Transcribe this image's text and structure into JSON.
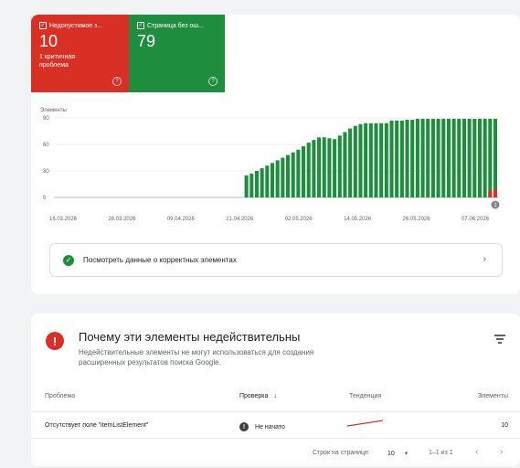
{
  "summary": {
    "invalid": {
      "label": "Недопустимое з...",
      "count": "10",
      "sub": "1 критичная проблема"
    },
    "valid": {
      "label": "Страница без ош...",
      "count": "79"
    }
  },
  "colors": {
    "invalid": "#d93025",
    "valid": "#1e8e3e",
    "grid": "#e8eaed"
  },
  "chart_data": {
    "type": "bar",
    "stacked": true,
    "ylabel": "Элементы",
    "yticks": [
      0,
      30,
      60,
      90
    ],
    "ylim": [
      0,
      90
    ],
    "xtick_labels": [
      "16.03.2026",
      "28.03.2026",
      "09.04.2026",
      "21.04.2026",
      "02.05.2026",
      "14.05.2026",
      "26.05.2026",
      "07.06.2026"
    ],
    "x_start": "2026-03-16",
    "x_end": "2026-06-10",
    "annotation_marker": {
      "date": "2026-06-10",
      "label": "1"
    },
    "series": [
      {
        "name": "Страница без ошибок",
        "color": "#1e8e3e",
        "points": [
          [
            "2026-04-23",
            25
          ],
          [
            "2026-04-24",
            27
          ],
          [
            "2026-04-25",
            30
          ],
          [
            "2026-04-26",
            33
          ],
          [
            "2026-04-27",
            36
          ],
          [
            "2026-04-28",
            39
          ],
          [
            "2026-04-29",
            42
          ],
          [
            "2026-04-30",
            45
          ],
          [
            "2026-05-01",
            48
          ],
          [
            "2026-05-02",
            51
          ],
          [
            "2026-05-03",
            54
          ],
          [
            "2026-05-04",
            58
          ],
          [
            "2026-05-05",
            62
          ],
          [
            "2026-05-06",
            65
          ],
          [
            "2026-05-07",
            68
          ],
          [
            "2026-05-08",
            68
          ],
          [
            "2026-05-09",
            67
          ],
          [
            "2026-05-10",
            66
          ],
          [
            "2026-05-11",
            70
          ],
          [
            "2026-05-12",
            74
          ],
          [
            "2026-05-13",
            78
          ],
          [
            "2026-05-14",
            81
          ],
          [
            "2026-05-15",
            83
          ],
          [
            "2026-05-16",
            84
          ],
          [
            "2026-05-17",
            84
          ],
          [
            "2026-05-18",
            84
          ],
          [
            "2026-05-19",
            84
          ],
          [
            "2026-05-20",
            84
          ],
          [
            "2026-05-21",
            87
          ],
          [
            "2026-05-22",
            87
          ],
          [
            "2026-05-23",
            87
          ],
          [
            "2026-05-24",
            88
          ],
          [
            "2026-05-25",
            88
          ],
          [
            "2026-05-26",
            89
          ],
          [
            "2026-05-27",
            89
          ],
          [
            "2026-05-28",
            89
          ],
          [
            "2026-05-29",
            89
          ],
          [
            "2026-05-30",
            89
          ],
          [
            "2026-05-31",
            89
          ],
          [
            "2026-06-01",
            89
          ],
          [
            "2026-06-02",
            89
          ],
          [
            "2026-06-03",
            89
          ],
          [
            "2026-06-04",
            89
          ],
          [
            "2026-06-05",
            89
          ],
          [
            "2026-06-06",
            89
          ],
          [
            "2026-06-07",
            89
          ],
          [
            "2026-06-08",
            89
          ],
          [
            "2026-06-09",
            89
          ],
          [
            "2026-06-10",
            89
          ]
        ]
      },
      {
        "name": "Недопустимое значение",
        "color": "#d93025",
        "points": [
          [
            "2026-06-09",
            7
          ],
          [
            "2026-06-10",
            10
          ]
        ]
      }
    ]
  },
  "view_button": {
    "label": "Посмотреть данные о корректных элементах"
  },
  "issues": {
    "title": "Почему эти элементы недействительны",
    "description": "Недействительные элементы не могут использоваться для создания расширенных результатов поиска Google.",
    "columns": {
      "problem": "Проблема",
      "check": "Проверка",
      "trend": "Тенденция",
      "items": "Элементы"
    },
    "rows": [
      {
        "problem": "Отсутствует поле \"itemListElement\"",
        "check": "Не начато",
        "items": "10"
      }
    ],
    "pagination": {
      "rows_per_page_label": "Строк на странице:",
      "rows_per_page": "10",
      "range": "1–1 из 1"
    }
  }
}
